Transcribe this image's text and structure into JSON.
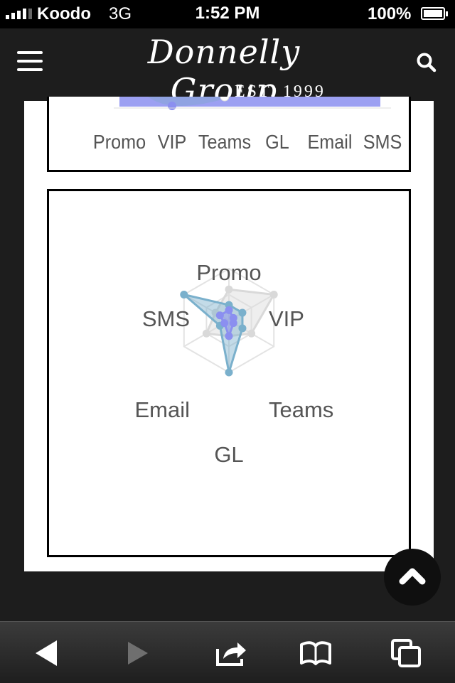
{
  "status_bar": {
    "carrier": "Koodo",
    "network": "3G",
    "time": "1:52 PM",
    "battery": "100%"
  },
  "header": {
    "logo_script": "Donnelly Group",
    "logo_est": "EST. 1999",
    "menu_icon": "hamburger-menu-icon",
    "search_icon": "search-icon"
  },
  "chart_data": [
    {
      "type": "area",
      "categories": [
        "Promo",
        "VIP",
        "Teams",
        "GL",
        "Email",
        "SMS"
      ],
      "series_colors": [
        "#8b8ff0",
        "#7aa9c6"
      ]
    },
    {
      "type": "radar",
      "categories": [
        "Promo",
        "VIP",
        "Teams",
        "GL",
        "Email",
        "SMS"
      ],
      "rmax": 10,
      "series": [
        {
          "color": "#d9d9d9",
          "values": [
            6,
            10,
            5,
            3,
            5,
            3
          ]
        },
        {
          "color": "#7ab0cc",
          "values": [
            3,
            3,
            3,
            10,
            2,
            10
          ]
        },
        {
          "color": "#8b8ff0",
          "values": [
            2,
            1,
            1,
            3,
            1,
            2
          ]
        }
      ]
    }
  ],
  "toolbar": {
    "back_icon": "back-arrow-icon",
    "forward_icon": "forward-arrow-icon",
    "share_icon": "share-icon",
    "bookmarks_icon": "bookmarks-icon",
    "tabs_icon": "tabs-icon"
  },
  "colors": {
    "header_bg": "#1d1d1d",
    "page_bg": "#ffffff",
    "area_fill": "#8b8ff0"
  }
}
